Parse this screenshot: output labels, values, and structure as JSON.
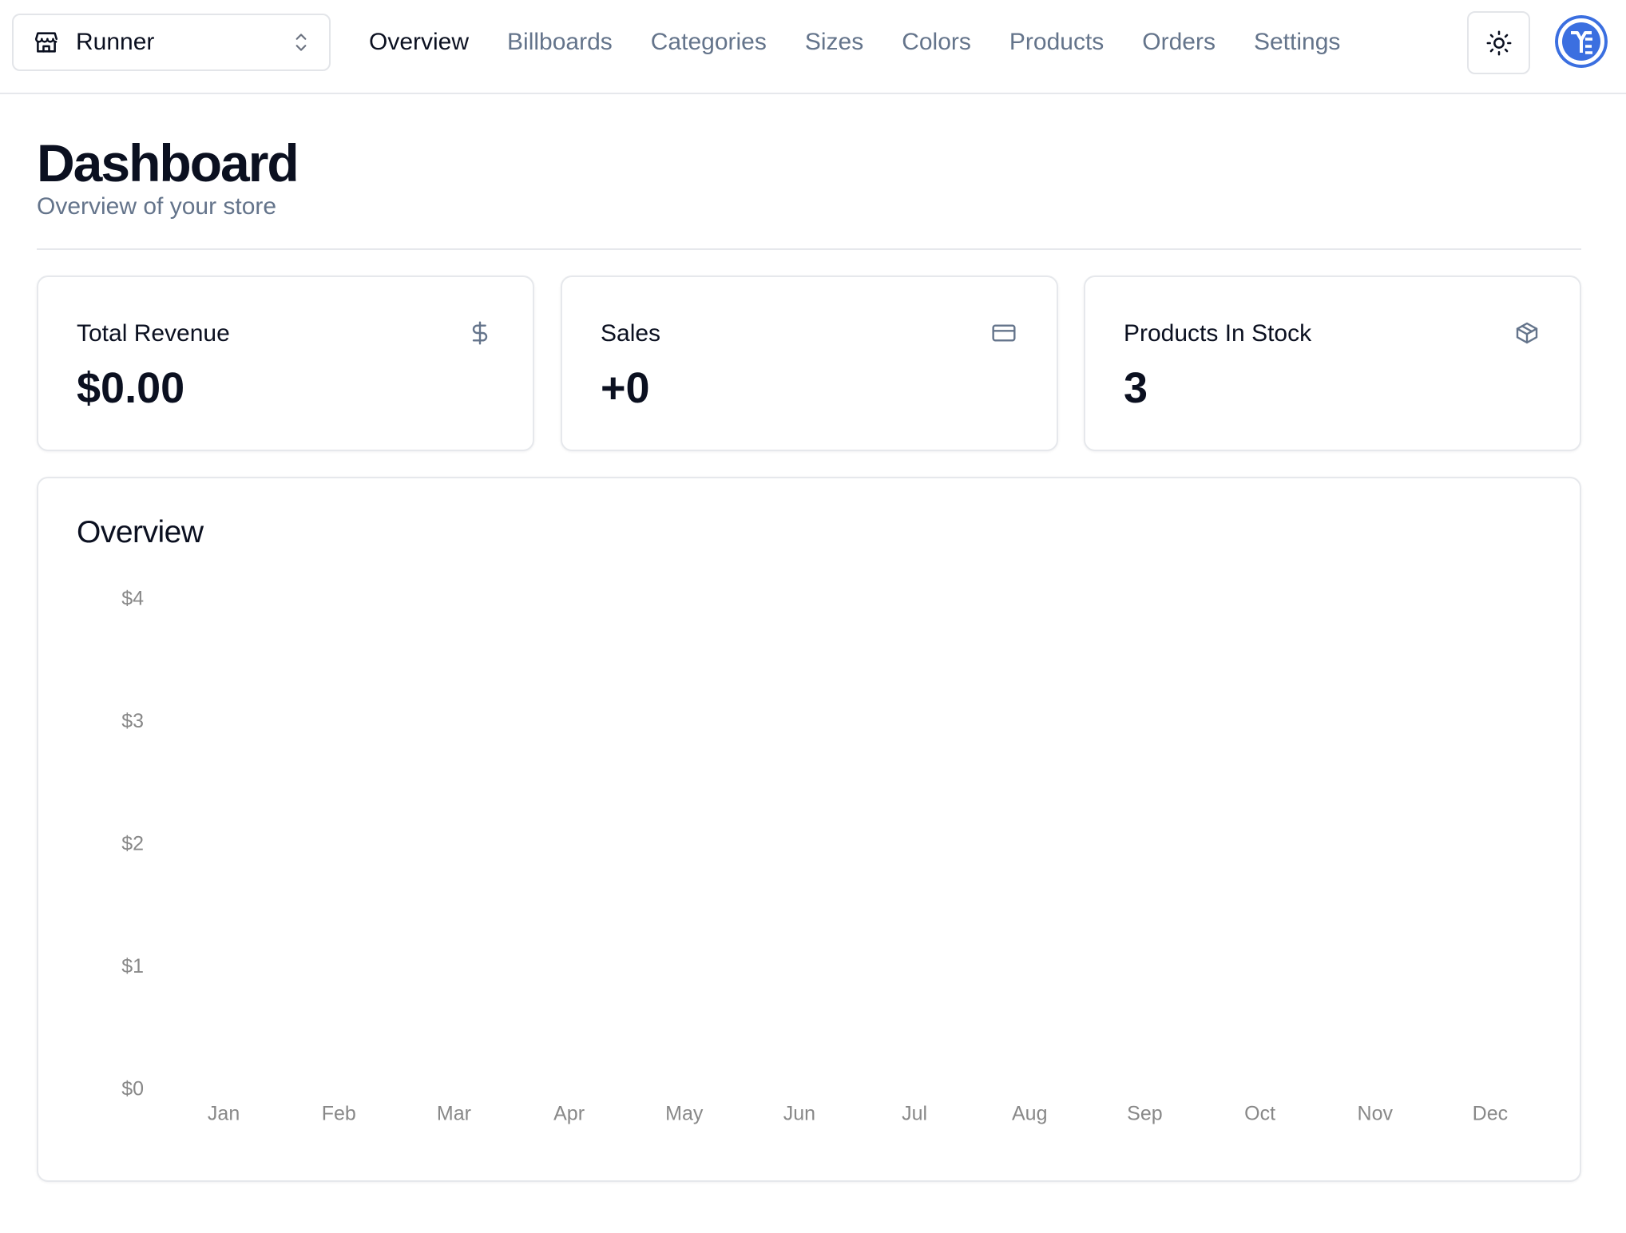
{
  "header": {
    "store_switcher": {
      "label": "Runner",
      "icon": "store-icon",
      "chevron_icon": "chevrons-up-down-icon"
    },
    "nav": [
      {
        "label": "Overview",
        "active": true
      },
      {
        "label": "Billboards",
        "active": false
      },
      {
        "label": "Categories",
        "active": false
      },
      {
        "label": "Sizes",
        "active": false
      },
      {
        "label": "Colors",
        "active": false
      },
      {
        "label": "Products",
        "active": false
      },
      {
        "label": "Orders",
        "active": false
      },
      {
        "label": "Settings",
        "active": false
      }
    ],
    "theme_toggle_icon": "sun-icon",
    "avatar_icon": "user-avatar-icon"
  },
  "page": {
    "title": "Dashboard",
    "subtitle": "Overview of your store"
  },
  "stats": [
    {
      "label": "Total Revenue",
      "value": "$0.00",
      "icon": "dollar-icon"
    },
    {
      "label": "Sales",
      "value": "+0",
      "icon": "credit-card-icon"
    },
    {
      "label": "Products In Stock",
      "value": "3",
      "icon": "package-icon"
    }
  ],
  "chart": {
    "title": "Overview"
  },
  "chart_data": {
    "type": "bar",
    "title": "Overview",
    "categories": [
      "Jan",
      "Feb",
      "Mar",
      "Apr",
      "May",
      "Jun",
      "Jul",
      "Aug",
      "Sep",
      "Oct",
      "Nov",
      "Dec"
    ],
    "values": [
      0,
      0,
      0,
      0,
      0,
      0,
      0,
      0,
      0,
      0,
      0,
      0
    ],
    "y_ticks": [
      0,
      1,
      2,
      3,
      4
    ],
    "y_tick_labels": [
      "$0",
      "$1",
      "$2",
      "$3",
      "$4"
    ],
    "ylim": [
      0,
      4
    ],
    "xlabel": "",
    "ylabel": "",
    "grid": false,
    "legend": "none",
    "bar_color": "#adfa1d",
    "tick_color": "#888888"
  },
  "colors": {
    "text": "#0b1020",
    "muted": "#64748b",
    "border": "#e6e8ec",
    "avatar_blue": "#3b6fe0"
  }
}
